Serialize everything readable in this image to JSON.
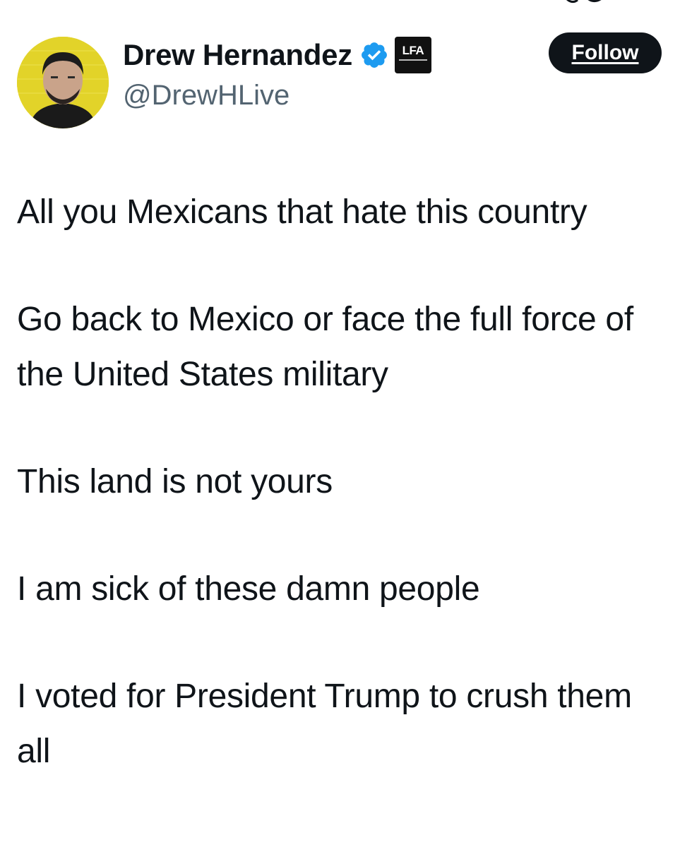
{
  "profile": {
    "display_name": "Drew Hernandez",
    "handle": "@DrewHLive",
    "verified": true,
    "verified_icon": "verified-badge-icon",
    "affiliate_badge_text": "LFA",
    "avatar": "profile-avatar"
  },
  "actions": {
    "follow_label": "Follow"
  },
  "tweet": {
    "paragraphs": [
      "All you Mexicans that hate this country",
      "Go back to Mexico or face the full force of the United States military",
      "This land is not yours",
      "I am sick of these damn people",
      "I voted for President Trump to crush them all"
    ]
  },
  "colors": {
    "text": "#0f1419",
    "secondary_text": "#536471",
    "verified_blue": "#1d9bf0",
    "follow_bg": "#0f1419",
    "background": "#ffffff"
  }
}
